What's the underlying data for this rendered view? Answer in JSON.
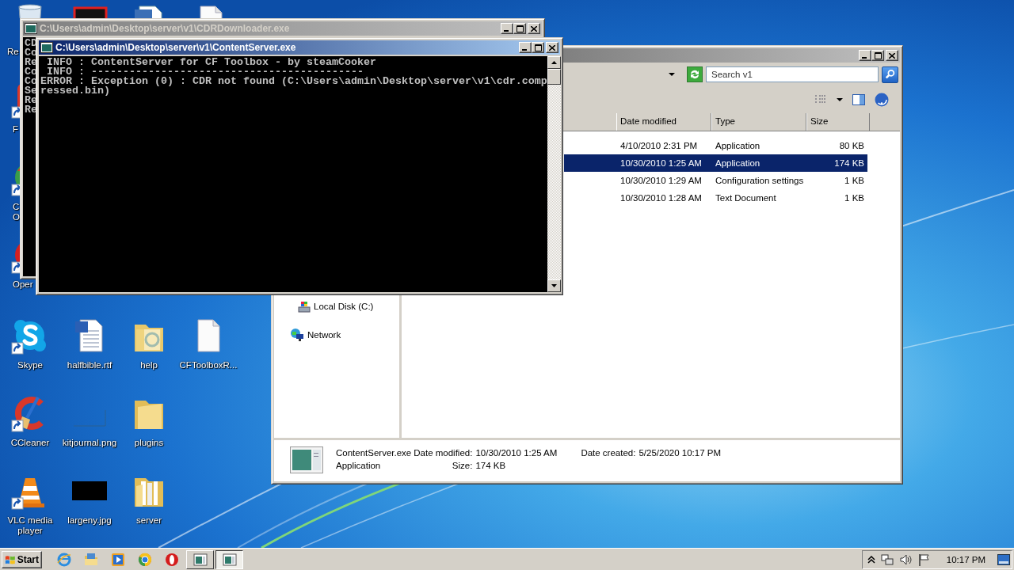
{
  "desktop": {
    "left_column": [
      {
        "kind": "recycle-bin",
        "label_lines": [
          "Re"
        ]
      },
      {
        "kind": "red-app",
        "shortcut": true,
        "label_lines": [
          "F"
        ]
      },
      {
        "kind": "green-app",
        "shortcut": true,
        "label_lines": [
          "C",
          "O"
        ]
      },
      {
        "kind": "ring-app",
        "shortcut": true,
        "label_lines": [
          "Oper"
        ]
      }
    ],
    "top_row": [
      {
        "kind": "dark-thumbnail"
      },
      {
        "kind": "picture-document"
      },
      {
        "kind": "blank-document"
      }
    ],
    "icons": [
      {
        "kind": "cloud-app",
        "shortcut": true,
        "label": "Skype"
      },
      {
        "kind": "cleaner",
        "shortcut": true,
        "label": "CCleaner"
      },
      {
        "kind": "cone",
        "shortcut": true,
        "label": "VLC media player"
      },
      {
        "kind": "word-document",
        "shortcut": false,
        "label": "halfbible.rtf"
      },
      {
        "kind": "faint-image",
        "shortcut": false,
        "label": "kitjournal.png"
      },
      {
        "kind": "dark-image",
        "shortcut": false,
        "label": "largeny.jpg"
      },
      {
        "kind": "web-folder",
        "shortcut": false,
        "label": "help"
      },
      {
        "kind": "folder",
        "shortcut": false,
        "label": "plugins"
      },
      {
        "kind": "files-folder",
        "shortcut": false,
        "label": "server"
      },
      {
        "kind": "blank-document",
        "shortcut": false,
        "label": "CFToolboxR..."
      }
    ]
  },
  "explorer": {
    "active": false,
    "search": {
      "placeholder": "Search v1"
    },
    "columns": [
      "Date modified",
      "Type",
      "Size"
    ],
    "rows": [
      {
        "date": "4/10/2010 2:31 PM",
        "type": "Application",
        "size": "80 KB",
        "selected": false
      },
      {
        "date": "10/30/2010 1:25 AM",
        "type": "Application",
        "size": "174 KB",
        "selected": true
      },
      {
        "date": "10/30/2010 1:29 AM",
        "type": "Configuration settings",
        "size": "1 KB",
        "selected": false
      },
      {
        "date": "10/30/2010 1:28 AM",
        "type": "Text Document",
        "size": "1 KB",
        "selected": false
      }
    ],
    "nav": [
      {
        "kind": "drive",
        "label": "Local Disk (C:)"
      },
      {
        "kind": "network",
        "label": "Network"
      }
    ],
    "details": {
      "name": "ContentServer.exe",
      "type": "Application",
      "columns": [
        [
          {
            "label": "Date modified:",
            "value": "10/30/2010 1:25 AM"
          },
          {
            "label": "Size:",
            "value": "174 KB"
          }
        ],
        [
          {
            "label": "Date created:",
            "value": "5/25/2020 10:17 PM"
          }
        ]
      ]
    }
  },
  "consoles": [
    {
      "title": "C:\\Users\\admin\\Desktop\\server\\v1\\CDRDownloader.exe",
      "active": false,
      "lines": [
        "CD",
        "Co",
        "Re",
        "Co",
        "Co",
        "Se",
        "Re",
        "Re"
      ]
    },
    {
      "title": "C:\\Users\\admin\\Desktop\\server\\v1\\ContentServer.exe",
      "active": true,
      "lines": [
        " INFO : ContentServer for CF Toolbox - by steamCooker",
        " INFO : -------------------------------------------",
        "ERROR : Exception (0) : CDR not found (C:\\Users\\admin\\Desktop\\server\\v1\\cdr.compressed.bin)"
      ]
    }
  ],
  "taskbar": {
    "start": "Start",
    "apps": [
      {
        "kind": "globe",
        "selected": false
      },
      {
        "kind": "folder",
        "selected": false
      },
      {
        "kind": "play",
        "selected": false
      },
      {
        "kind": "ball",
        "selected": false
      },
      {
        "kind": "ring",
        "selected": false
      },
      {
        "kind": "console",
        "selected": false
      },
      {
        "kind": "console",
        "selected": true
      }
    ],
    "clock": "10:17 PM"
  }
}
